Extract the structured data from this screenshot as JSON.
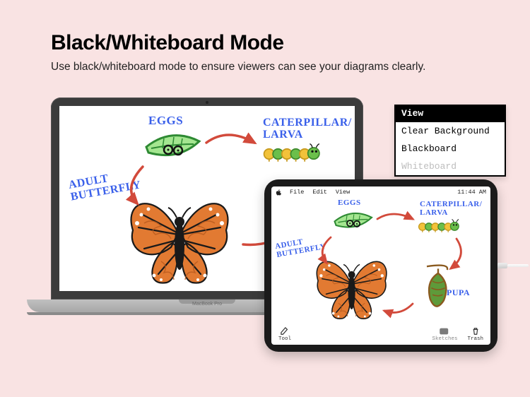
{
  "heading": "Black/Whiteboard Mode",
  "subheading": "Use black/whiteboard mode to ensure viewers can see your diagrams clearly.",
  "view_menu": {
    "title": "View",
    "items": [
      "Clear Background",
      "Blackboard",
      "Whiteboard"
    ],
    "selected_index": 2
  },
  "macbook": {
    "brand_label": "MacBook Pro"
  },
  "ipad": {
    "menubar": {
      "file": "File",
      "edit": "Edit",
      "view": "View",
      "clock": "11:44 AM"
    },
    "toolbar": {
      "tool": "Tool",
      "sketches": "Sketches",
      "trash": "Trash"
    }
  },
  "drawing_labels": {
    "eggs": "EGGS",
    "caterpillar": "CATERPILLAR/\nLARVA",
    "adult": "ADULT\nBUTTERFLY",
    "pupa": "PUPA"
  },
  "colors": {
    "bg": "#f9e3e3",
    "label_blue": "#3a60ea",
    "arrow_red": "#d24a3b",
    "leaf_green": "#7ad269",
    "leaf_dark": "#2e8a33",
    "cat_yellow": "#f2c23a",
    "cat_green": "#6bbf4b",
    "butterfly_orange": "#e27a32",
    "butterfly_dark": "#1a1a1a",
    "pupa_brown": "#8a5a1f",
    "pupa_green": "#3f7d2d"
  }
}
